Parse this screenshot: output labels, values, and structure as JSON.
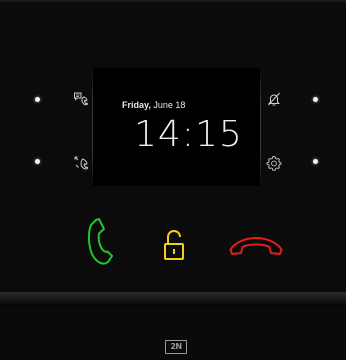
{
  "display": {
    "day": "Friday,",
    "date": "June 18",
    "time": "14:15"
  },
  "left_buttons": [
    {
      "icon": "message-phone-icon"
    },
    {
      "icon": "missed-call-icon"
    }
  ],
  "right_buttons": [
    {
      "icon": "bell-off-icon"
    },
    {
      "icon": "gear-icon"
    }
  ],
  "actions": [
    {
      "icon": "phone-answer-icon",
      "color": "#22c531"
    },
    {
      "icon": "unlock-icon",
      "color": "#f2cf14"
    },
    {
      "icon": "phone-hangup-icon",
      "color": "#e11d1d"
    }
  ],
  "brand": {
    "logo_text": "2N"
  }
}
